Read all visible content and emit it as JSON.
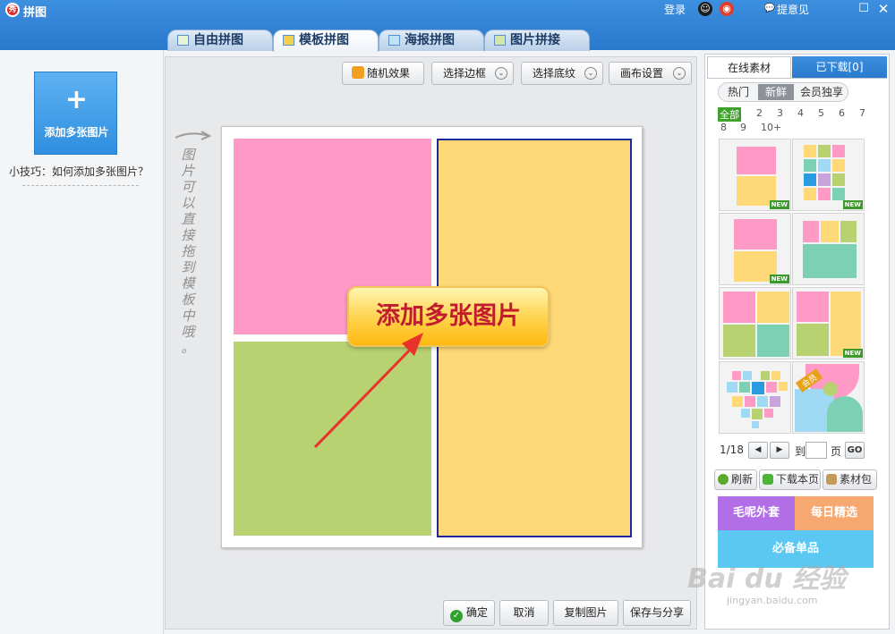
{
  "app": {
    "logo": "秀",
    "title": "拼图",
    "login": "登录",
    "feedback": "提意见",
    "qq_icon": "qq-icon",
    "weibo_icon": "weibo-icon"
  },
  "tabs": [
    {
      "label": "自由拼图",
      "active": false
    },
    {
      "label": "模板拼图",
      "active": true
    },
    {
      "label": "海报拼图",
      "active": false
    },
    {
      "label": "图片拼接",
      "active": false
    }
  ],
  "left": {
    "add_plus": "+",
    "add_label": "添加多张图片",
    "tip": "小技巧：如何添加多张图片？"
  },
  "toolbar": {
    "random": "随机效果",
    "border": "选择边框",
    "background": "选择底纹",
    "canvas_settings": "画布设置",
    "dropdown_glyph": "⌄"
  },
  "canvas": {
    "side_hint": [
      "图",
      "片",
      "可",
      "以",
      "直",
      "接",
      "拖",
      "到",
      "模",
      "板",
      "中",
      "哦",
      "。"
    ],
    "bubble_text": "添加多张图片",
    "colors": {
      "pink": "#ff99c6",
      "green": "#b8d171",
      "yellow": "#ffd977",
      "selected_border": "#1d2a9e"
    }
  },
  "bottom": {
    "ok": "确定",
    "cancel": "取消",
    "copy": "复制图片",
    "save_share": "保存与分享"
  },
  "right": {
    "tab_online": "在线素材",
    "tab_downloaded": "已下载[0]",
    "subtabs": [
      "热门",
      "新鲜",
      "会员独享"
    ],
    "active_subtab": "新鲜",
    "numbers": [
      "全部",
      "2",
      "3",
      "4",
      "5",
      "6",
      "7",
      "8",
      "9",
      "10+"
    ],
    "new_badge": "NEW",
    "vip_badge": "会员",
    "page": "1/18",
    "prev": "◀",
    "next": "▶",
    "goto_prefix": "到",
    "goto_suffix": "页",
    "go": "GO",
    "refresh": "刷新",
    "download_page": "下载本页",
    "material_pack": "素材包",
    "ad_a": "毛呢外套",
    "ad_b": "每日精选",
    "ad_c": "必备单品"
  },
  "watermark": {
    "main": "Bai du 经验",
    "sub": "jingyan.baidu.com"
  }
}
